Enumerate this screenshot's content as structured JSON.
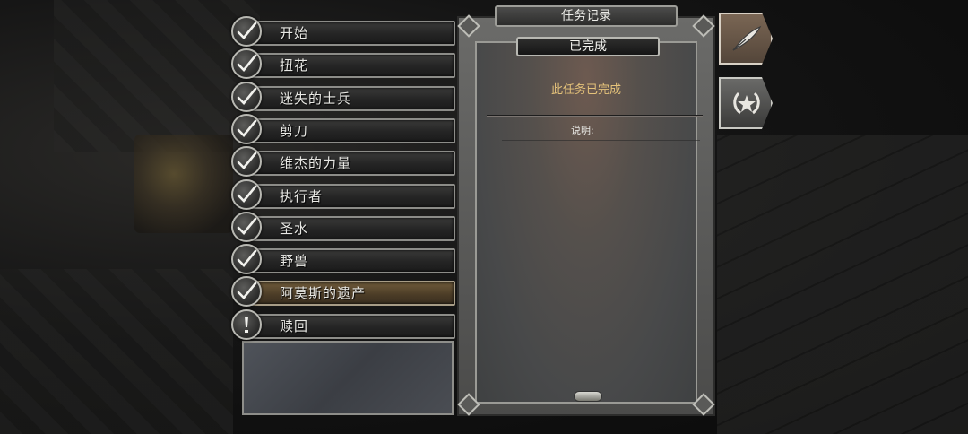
{
  "quest_log": {
    "title": "任务记录",
    "status_tab": "已完成",
    "status_message": "此任务已完成",
    "description_label": "说明:"
  },
  "quests": [
    {
      "label": "开始",
      "status": "completed",
      "icon": "checkmark-icon"
    },
    {
      "label": "扭花",
      "status": "completed",
      "icon": "checkmark-icon"
    },
    {
      "label": "迷失的士兵",
      "status": "completed",
      "icon": "checkmark-icon"
    },
    {
      "label": "剪刀",
      "status": "completed",
      "icon": "checkmark-icon"
    },
    {
      "label": "维杰的力量",
      "status": "completed",
      "icon": "checkmark-icon"
    },
    {
      "label": "执行者",
      "status": "completed",
      "icon": "checkmark-icon"
    },
    {
      "label": "圣水",
      "status": "completed",
      "icon": "checkmark-icon"
    },
    {
      "label": "野兽",
      "status": "completed",
      "icon": "checkmark-icon"
    },
    {
      "label": "阿莫斯的遗产",
      "status": "completed",
      "icon": "checkmark-icon",
      "selected": true
    },
    {
      "label": "赎回",
      "status": "active",
      "icon": "exclamation-icon"
    }
  ],
  "side_tabs": [
    {
      "icon": "feather-quill-icon",
      "active": true
    },
    {
      "icon": "laurel-star-icon",
      "active": false
    }
  ],
  "colors": {
    "status_message": "#e4c27a",
    "selected_row": "#6e5a3a"
  }
}
